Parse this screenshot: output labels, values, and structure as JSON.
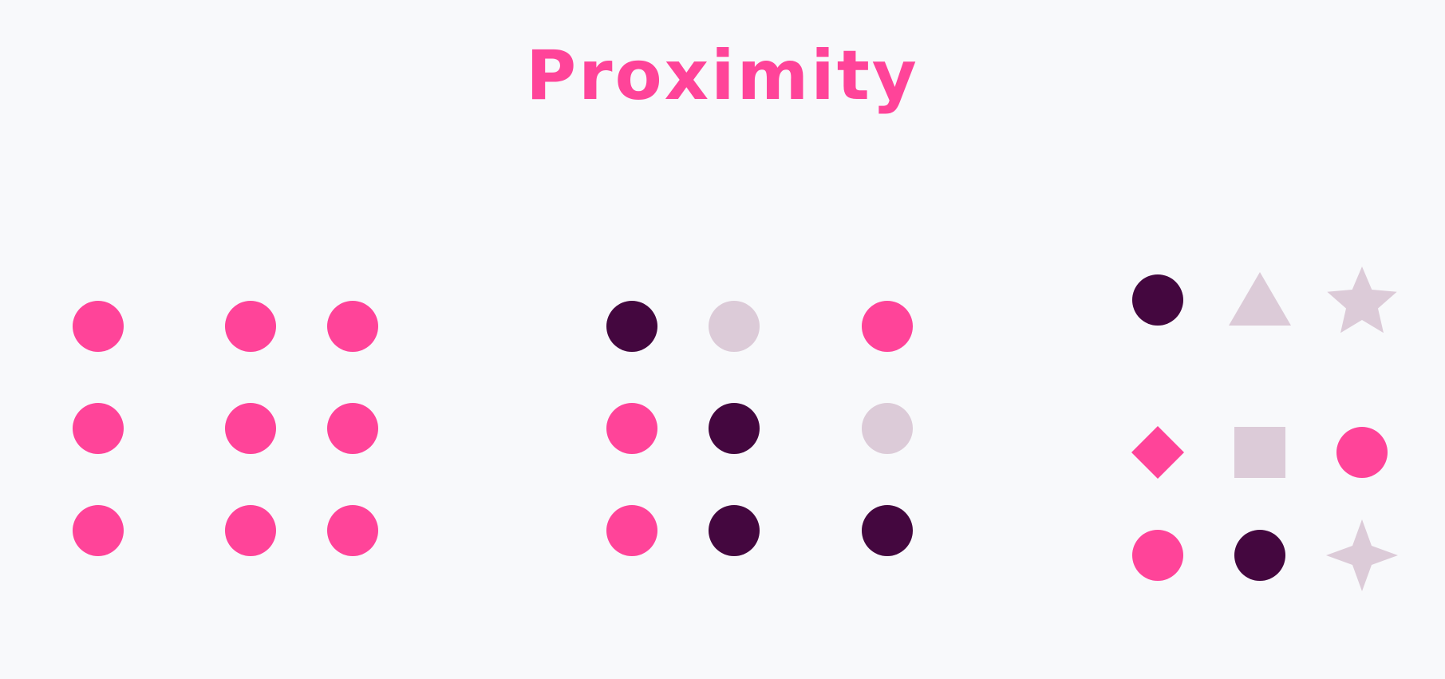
{
  "title": "Proximity",
  "colors": {
    "background": "#f8f9fb",
    "pink": "#ff4499",
    "dark": "#44073f",
    "light": "#dccbd8"
  },
  "groups": [
    {
      "name": "equal-spacing-left-column",
      "items": [
        {
          "shape": "circle",
          "color": "pink"
        },
        {
          "shape": "circle",
          "color": "pink"
        },
        {
          "shape": "circle",
          "color": "pink"
        }
      ]
    },
    {
      "name": "paired-columns",
      "items": [
        {
          "shape": "circle",
          "color": "pink"
        },
        {
          "shape": "circle",
          "color": "pink"
        },
        {
          "shape": "circle",
          "color": "pink"
        },
        {
          "shape": "circle",
          "color": "pink"
        },
        {
          "shape": "circle",
          "color": "pink"
        },
        {
          "shape": "circle",
          "color": "pink"
        }
      ]
    },
    {
      "name": "mixed-color-grid",
      "items": [
        {
          "shape": "circle",
          "color": "dark"
        },
        {
          "shape": "circle",
          "color": "light"
        },
        {
          "shape": "circle",
          "color": "pink"
        },
        {
          "shape": "circle",
          "color": "pink"
        },
        {
          "shape": "circle",
          "color": "dark"
        },
        {
          "shape": "circle",
          "color": "light"
        },
        {
          "shape": "circle",
          "color": "pink"
        },
        {
          "shape": "circle",
          "color": "dark"
        },
        {
          "shape": "circle",
          "color": "dark"
        }
      ]
    },
    {
      "name": "mixed-shape-grid",
      "items": [
        {
          "shape": "circle",
          "color": "dark"
        },
        {
          "shape": "triangle",
          "color": "light"
        },
        {
          "shape": "star5",
          "color": "light"
        },
        {
          "shape": "diamond",
          "color": "pink"
        },
        {
          "shape": "square",
          "color": "light"
        },
        {
          "shape": "circle",
          "color": "pink"
        },
        {
          "shape": "circle",
          "color": "pink"
        },
        {
          "shape": "circle",
          "color": "dark"
        },
        {
          "shape": "star4",
          "color": "light"
        }
      ]
    }
  ]
}
